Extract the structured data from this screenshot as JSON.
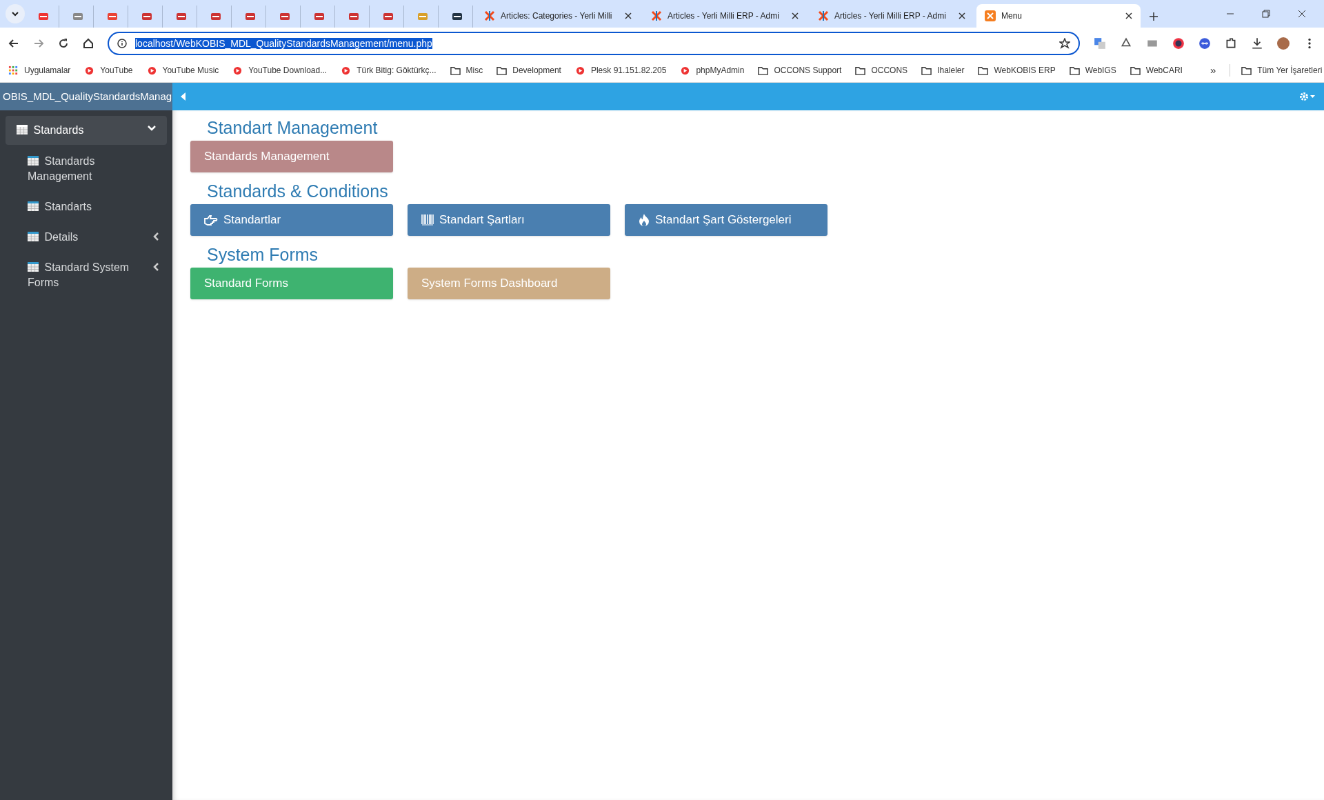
{
  "browser": {
    "tabs": [
      {
        "title": "Articles: Categories - Yerli Milli",
        "selected": false
      },
      {
        "title": "Articles - Yerli Milli ERP - Admi",
        "selected": false
      },
      {
        "title": "Articles - Yerli Milli ERP - Admi",
        "selected": false
      },
      {
        "title": "Menu",
        "selected": true
      }
    ],
    "address": "localhost/WebKOBIS_MDL_QualityStandardsManagement/menu.php",
    "bookmarks": [
      {
        "label": "Uygulamalar",
        "kind": "apps"
      },
      {
        "label": "YouTube",
        "kind": "site"
      },
      {
        "label": "YouTube Music",
        "kind": "site"
      },
      {
        "label": "YouTube Download...",
        "kind": "site"
      },
      {
        "label": "Türk Bitig: Göktürkç...",
        "kind": "site"
      },
      {
        "label": "Misc",
        "kind": "folder"
      },
      {
        "label": "Development",
        "kind": "folder"
      },
      {
        "label": "Plesk 91.151.82.205",
        "kind": "site"
      },
      {
        "label": "phpMyAdmin",
        "kind": "site"
      },
      {
        "label": "OCCONS Support",
        "kind": "folder"
      },
      {
        "label": "OCCONS",
        "kind": "folder"
      },
      {
        "label": "Ihaleler",
        "kind": "folder"
      },
      {
        "label": "WebKOBIS ERP",
        "kind": "folder"
      },
      {
        "label": "WebIGS",
        "kind": "folder"
      },
      {
        "label": "WebCARI",
        "kind": "folder"
      }
    ],
    "more": "»",
    "all_bookmarks": "Tüm Yer İşaretleri"
  },
  "app": {
    "brand": "OBIS_MDL_QualityStandardsManag",
    "sidebar": [
      {
        "label": "Standards",
        "expanded": true,
        "selected": true,
        "children": [
          {
            "label": "Standards Management",
            "selected": false
          },
          {
            "label": "Standarts",
            "selected": false
          },
          {
            "label": "Details",
            "expanded": false,
            "selected": false
          },
          {
            "label": "Standard System Forms",
            "expanded": false,
            "selected": false
          }
        ]
      }
    ],
    "sections": [
      {
        "title": "Standart Management",
        "buttons": [
          {
            "label": "Standards Management",
            "color": "#b98889"
          }
        ]
      },
      {
        "title": "Standards & Conditions",
        "buttons": [
          {
            "label": "Standartlar",
            "color": "#4a7fb0"
          },
          {
            "label": "Standart Şartları",
            "color": "#4a7fb0"
          },
          {
            "label": "Standart Şart Göstergeleri",
            "color": "#4a7fb0"
          }
        ]
      },
      {
        "title": "System Forms",
        "buttons": [
          {
            "label": "Standard Forms",
            "color": "#3eb370"
          },
          {
            "label": "System Forms Dashboard",
            "color": "#cdad86"
          }
        ]
      }
    ]
  }
}
